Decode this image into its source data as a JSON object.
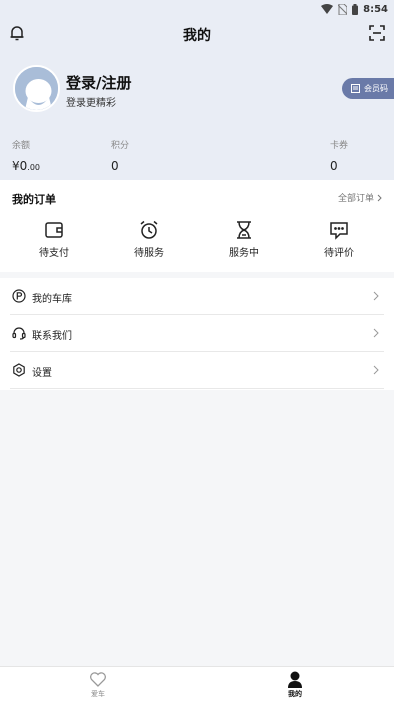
{
  "status_bar": {
    "time": "8:54"
  },
  "header": {
    "title": "我的"
  },
  "profile": {
    "login_title": "登录/注册",
    "login_subtitle": "登录更精彩",
    "member_code_label": "会员码"
  },
  "stats": {
    "balance": {
      "label": "余额",
      "value_main": "¥0",
      "value_decimal": ".00"
    },
    "points": {
      "label": "积分",
      "value": "0"
    },
    "coupons": {
      "label": "卡券",
      "value": "0"
    }
  },
  "orders": {
    "title": "我的订单",
    "all_label": "全部订单",
    "items": [
      {
        "label": "待支付",
        "icon": "wallet-icon"
      },
      {
        "label": "待服务",
        "icon": "alarm-clock-icon"
      },
      {
        "label": "服务中",
        "icon": "hourglass-icon"
      },
      {
        "label": "待评价",
        "icon": "comment-icon"
      }
    ]
  },
  "menu": {
    "items": [
      {
        "label": "我的车库",
        "icon": "parking-icon"
      },
      {
        "label": "联系我们",
        "icon": "headset-icon"
      },
      {
        "label": "设置",
        "icon": "settings-icon"
      }
    ]
  },
  "tab_bar": {
    "tabs": [
      {
        "label": "爱车",
        "icon": "heart-icon",
        "active": false
      },
      {
        "label": "我的",
        "icon": "user-icon",
        "active": true
      }
    ]
  },
  "colors": {
    "accent": "#6a7aa8",
    "header_bg": "#e9edf5",
    "avatar": "#a9bdd8"
  }
}
